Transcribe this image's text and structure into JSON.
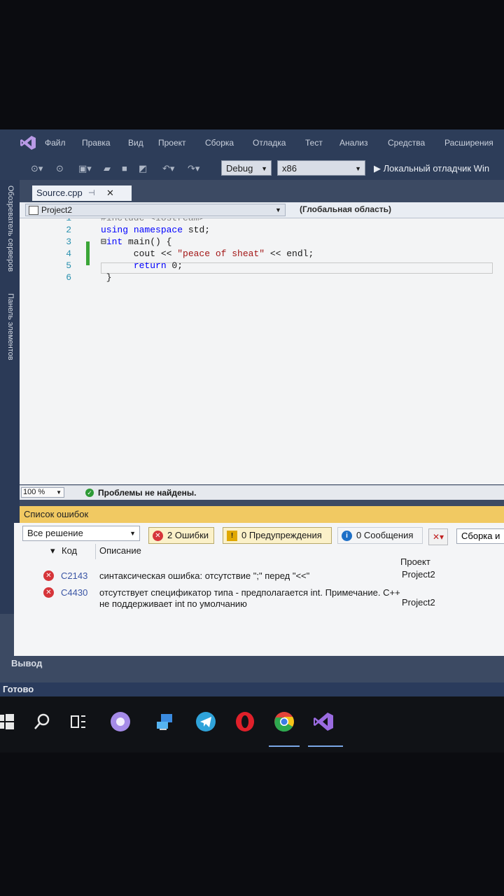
{
  "menubar": {
    "items": [
      "Файл",
      "Правка",
      "Вид",
      "Проект",
      "Сборка",
      "Отладка",
      "Тест",
      "Анализ",
      "Средства",
      "Расширения"
    ]
  },
  "toolbar": {
    "configuration": "Debug",
    "platform": "x86",
    "run_label": "Локальный отладчик Win"
  },
  "sidebar": {
    "server_explorer": "Обозреватель серверов",
    "toolbox": "Панель элементов"
  },
  "editor": {
    "tab_name": "Source.cpp",
    "project_nav": "Project2",
    "scope_nav": "(Глобальная область)",
    "lines": [
      {
        "num": "1",
        "parts": [
          {
            "t": "#include <iostream>",
            "c": "pp"
          }
        ]
      },
      {
        "num": "2",
        "parts": [
          {
            "t": "using",
            "c": "kw"
          },
          {
            "t": " ",
            "c": "plain"
          },
          {
            "t": "namespace",
            "c": "kw"
          },
          {
            "t": " std;",
            "c": "plain"
          }
        ]
      },
      {
        "num": "3",
        "parts": [
          {
            "t": "⊟",
            "c": "plain"
          },
          {
            "t": "int",
            "c": "kw"
          },
          {
            "t": " main() {",
            "c": "plain"
          }
        ]
      },
      {
        "num": "4",
        "parts": [
          {
            "t": "      cout << ",
            "c": "plain"
          },
          {
            "t": "\"peace of sheat\"",
            "c": "str"
          },
          {
            "t": " << endl;",
            "c": "plain"
          }
        ]
      },
      {
        "num": "5",
        "parts": [
          {
            "t": "      ",
            "c": "plain"
          },
          {
            "t": "return",
            "c": "kw"
          },
          {
            "t": " 0;",
            "c": "plain"
          }
        ]
      },
      {
        "num": "6",
        "parts": [
          {
            "t": " }",
            "c": "plain"
          }
        ]
      }
    ],
    "zoom": "100 %",
    "status": "Проблемы не найдены."
  },
  "error_list": {
    "title": "Список ошибок",
    "scope": "Все решение",
    "errors_filter": "2 Ошибки",
    "warnings_filter": "0 Предупреждения",
    "messages_filter": "0 Сообщения",
    "build_filter": "Сборка и",
    "columns": {
      "code": "Код",
      "description": "Описание",
      "project": "Проект"
    },
    "rows": [
      {
        "code": "C2143",
        "description": "синтаксическая ошибка: отсутствие \";\" перед \"<<\"",
        "project": "Project2"
      },
      {
        "code": "C4430",
        "description": "отсутствует спецификатор типа - предполагается int. Примечание. C++ не поддерживает int по умолчанию",
        "project": "Project2"
      }
    ]
  },
  "output_label": "Вывод",
  "status_bar": "Готово",
  "colors": {
    "accent": "#2d3d59",
    "error_list_header": "#f1c962",
    "error_icon": "#d6353a",
    "vs_purple": "#8e5bd6"
  },
  "taskbar": {
    "icons": [
      "windows-start-icon",
      "search-icon",
      "task-view-icon",
      "alice-assistant-icon",
      "pc-network-icon",
      "telegram-icon",
      "opera-icon",
      "chrome-icon",
      "visual-studio-icon"
    ]
  }
}
